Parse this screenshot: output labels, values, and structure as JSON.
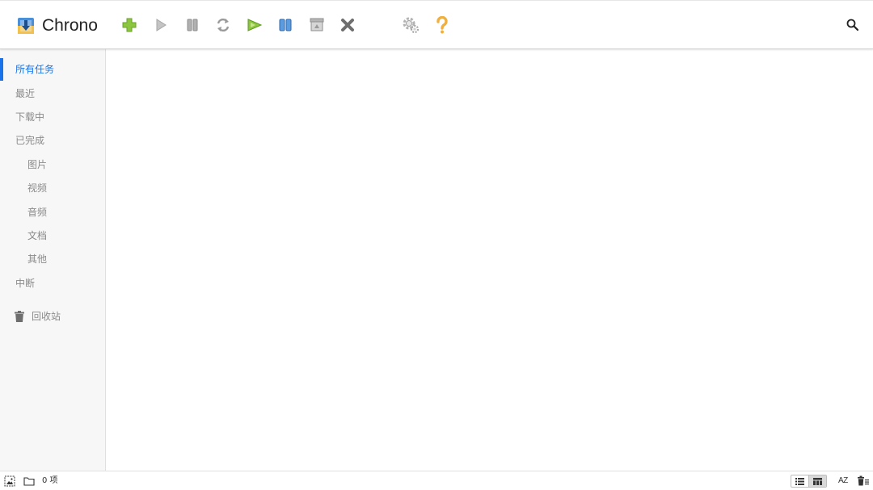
{
  "app": {
    "name": "Chrono",
    "accent_color": "#1a73e8"
  },
  "toolbar": {
    "buttons": [
      {
        "name": "add-task",
        "icon": "plus-icon",
        "color": "#8cc63f"
      },
      {
        "name": "start",
        "icon": "play-icon",
        "color": "#b8b8b8"
      },
      {
        "name": "pause",
        "icon": "pause-icon",
        "color": "#a9a9a9"
      },
      {
        "name": "retry",
        "icon": "refresh-icon",
        "color": "#9a9a9a"
      },
      {
        "name": "start-all",
        "icon": "play-all-icon",
        "color": "#7bb530"
      },
      {
        "name": "pause-all",
        "icon": "pause-all-icon",
        "color": "#3a7fc4"
      },
      {
        "name": "clear",
        "icon": "archive-icon",
        "color": "#a0a0a0"
      },
      {
        "name": "delete",
        "icon": "close-icon",
        "color": "#777777"
      },
      {
        "name": "settings",
        "icon": "gear-icon",
        "color": "#a8a8a8"
      },
      {
        "name": "help",
        "icon": "question-icon",
        "color": "#f0b040"
      }
    ],
    "search_icon": "search-icon"
  },
  "sidebar": {
    "items": [
      {
        "label": "所有任务",
        "active": true
      },
      {
        "label": "最近"
      },
      {
        "label": "下载中"
      },
      {
        "label": "已完成"
      },
      {
        "label": "图片",
        "sub": true
      },
      {
        "label": "视频",
        "sub": true
      },
      {
        "label": "音频",
        "sub": true
      },
      {
        "label": "文档",
        "sub": true
      },
      {
        "label": "其他",
        "sub": true
      },
      {
        "label": "中断"
      }
    ],
    "trash": {
      "label": "回收站",
      "icon": "trash-icon"
    }
  },
  "status": {
    "count_text": "0 项",
    "sort_label": "AZ"
  }
}
